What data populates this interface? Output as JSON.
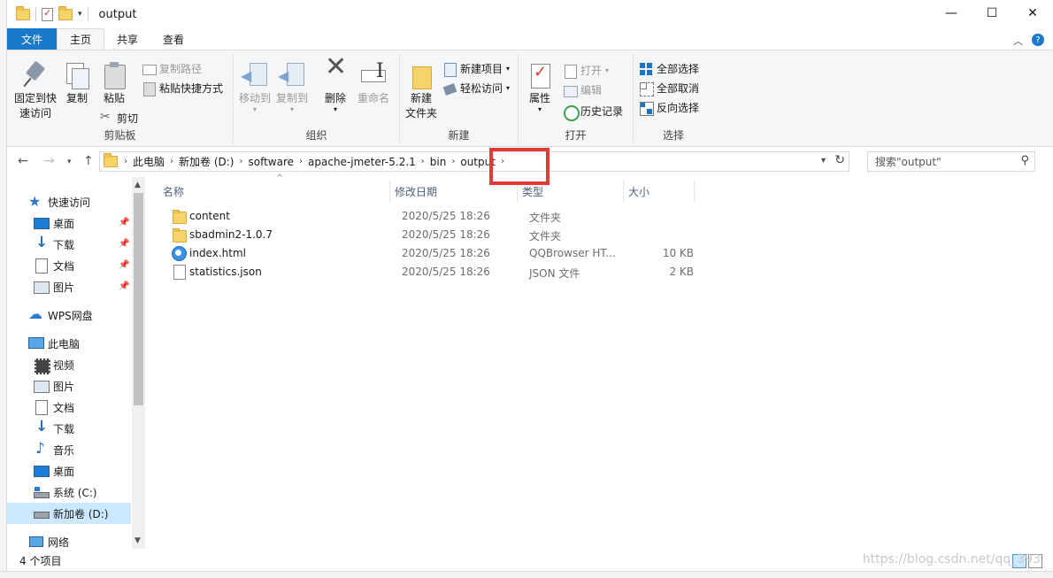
{
  "window": {
    "title": "output",
    "controls": [
      "—",
      "☐",
      "✕"
    ]
  },
  "ribbon_tabs": [
    {
      "label": "文件"
    },
    {
      "label": "主页"
    },
    {
      "label": "共享"
    },
    {
      "label": "查看"
    }
  ],
  "ribbon": {
    "clipboard": {
      "label": "剪贴板",
      "pin_line1": "固定到快",
      "pin_line2": "速访问",
      "copy": "复制",
      "paste": "粘贴",
      "copy_path": "复制路径",
      "paste_shortcut": "粘贴快捷方式",
      "cut": "剪切"
    },
    "organize": {
      "label": "组织",
      "move_to": "移动到",
      "copy_to": "复制到",
      "delete": "删除",
      "rename": "重命名"
    },
    "new": {
      "label": "新建",
      "new_folder_line1": "新建",
      "new_folder_line2": "文件夹",
      "new_item": "新建项目",
      "easy_access": "轻松访问"
    },
    "open": {
      "label": "打开",
      "properties": "属性",
      "open": "打开",
      "edit": "编辑",
      "history": "历史记录"
    },
    "select": {
      "label": "选择",
      "select_all": "全部选择",
      "select_none": "全部取消",
      "invert": "反向选择"
    }
  },
  "address": {
    "crumbs": [
      "此电脑",
      "新加卷 (D:)",
      "software",
      "apache-jmeter-5.2.1",
      "bin",
      "output"
    ]
  },
  "search": {
    "placeholder": "搜索\"output\""
  },
  "nav": {
    "quick_access": "快速访问",
    "qa_items": [
      "桌面",
      "下载",
      "文档",
      "图片"
    ],
    "wps": "WPS网盘",
    "this_pc": "此电脑",
    "pc_items": [
      "视频",
      "图片",
      "文档",
      "下载",
      "音乐",
      "桌面",
      "系统 (C:)",
      "新加卷 (D:)"
    ],
    "network": "网络"
  },
  "columns": {
    "name": "名称",
    "modified": "修改日期",
    "type": "类型",
    "size": "大小"
  },
  "files": [
    {
      "name": "content",
      "modified": "2020/5/25 18:26",
      "type": "文件夹",
      "size": "",
      "icon": "folder-icon"
    },
    {
      "name": "sbadmin2-1.0.7",
      "modified": "2020/5/25 18:26",
      "type": "文件夹",
      "size": "",
      "icon": "folder-icon"
    },
    {
      "name": "index.html",
      "modified": "2020/5/25 18:26",
      "type": "QQBrowser HT...",
      "size": "10 KB",
      "icon": "qqbrowser-html-icon"
    },
    {
      "name": "statistics.json",
      "modified": "2020/5/25 18:26",
      "type": "JSON 文件",
      "size": "2 KB",
      "icon": "json-file-icon"
    }
  ],
  "status": {
    "count": "4 个项目"
  },
  "watermark": "https://blog.csdn.net/qq_393",
  "colors": {
    "file_tab": "#1979ca",
    "selection": "#cce8ff",
    "highlight_box": "#e53935"
  }
}
